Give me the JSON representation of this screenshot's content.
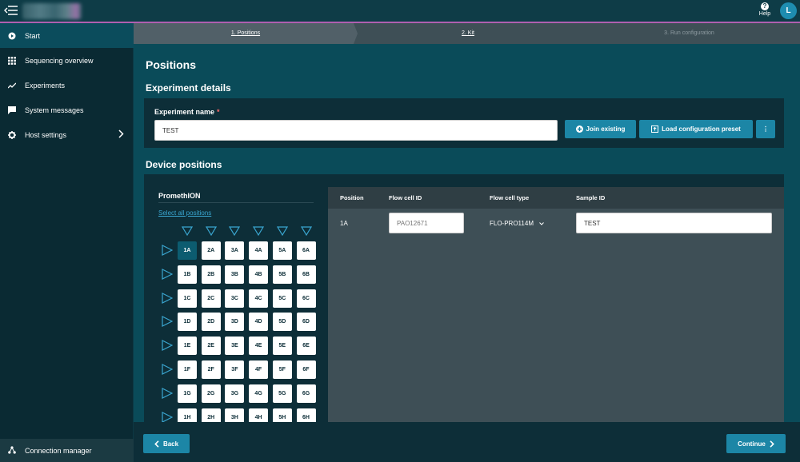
{
  "topbar": {
    "help_label": "Help",
    "help_glyph": "?",
    "avatar_initial": "L"
  },
  "sidebar": {
    "items": [
      {
        "label": "Start",
        "icon": "play-circle-icon",
        "active": true
      },
      {
        "label": "Sequencing overview",
        "icon": "grid-icon"
      },
      {
        "label": "Experiments",
        "icon": "trend-line-icon"
      },
      {
        "label": "System messages",
        "icon": "chat-bubble-icon"
      },
      {
        "label": "Host settings",
        "icon": "gear-icon",
        "has_chevron": true
      }
    ],
    "connection_manager": "Connection manager"
  },
  "stepper": {
    "steps": [
      {
        "label": "1. Positions",
        "state": "current"
      },
      {
        "label": "2. Kit",
        "state": "upcoming"
      },
      {
        "label": "3. Run configuration",
        "state": "disabled"
      }
    ]
  },
  "main": {
    "page_title": "Positions",
    "experiment_details": {
      "title": "Experiment details",
      "name_label": "Experiment name",
      "required_mark": "*",
      "name_value": "TEST",
      "join_label": "Join existing",
      "load_label": "Load configuration preset",
      "more_glyph": "⋮"
    },
    "device_positions": {
      "title": "Device positions",
      "device_label": "PromethION",
      "select_all": "Select all positions",
      "columns": [
        "1",
        "2",
        "3",
        "4",
        "5",
        "6"
      ],
      "rows": [
        "A",
        "B",
        "C",
        "D",
        "E",
        "F",
        "G",
        "H"
      ],
      "selected": [
        "1A"
      ]
    },
    "table": {
      "headers": [
        "Position",
        "Flow cell ID",
        "Flow cell type",
        "Sample ID"
      ],
      "rows": [
        {
          "position": "1A",
          "flow_cell_id_placeholder": "PAO12671",
          "flow_cell_type": "FLO-PRO114M",
          "sample_id": "TEST"
        }
      ]
    }
  },
  "footer": {
    "back_label": "Back",
    "continue_label": "Continue"
  },
  "colors": {
    "accent": "#1c86a6",
    "sidebar_bg": "#0a2a33",
    "main_bg": "#0a4b59",
    "topbar_border": "#b05fb0"
  }
}
